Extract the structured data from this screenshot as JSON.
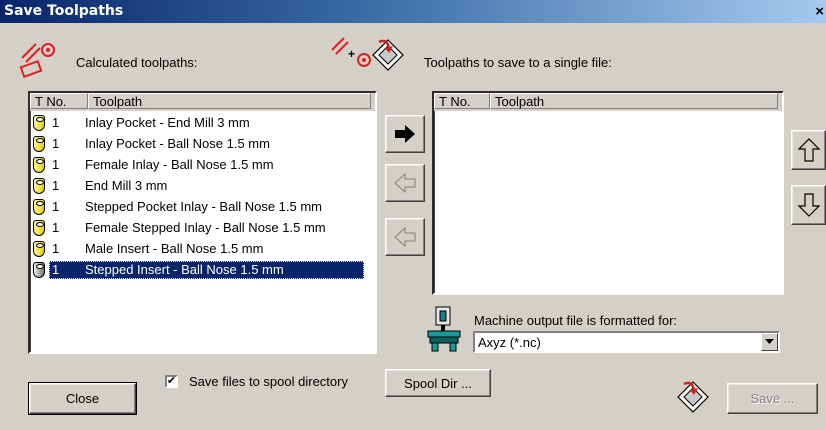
{
  "window": {
    "title": "Save Toolpaths",
    "close_glyph": "×"
  },
  "calculated": {
    "label": "Calculated toolpaths:",
    "columns": [
      "T No.",
      "Toolpath"
    ],
    "rows": [
      {
        "tno": "1",
        "name": "Inlay Pocket - End Mill 3 mm"
      },
      {
        "tno": "1",
        "name": "Inlay Pocket - Ball Nose 1.5 mm"
      },
      {
        "tno": "1",
        "name": "Female Inlay - Ball Nose 1.5 mm"
      },
      {
        "tno": "1",
        "name": "End Mill 3 mm"
      },
      {
        "tno": "1",
        "name": "Stepped Pocket Inlay - Ball Nose 1.5 mm"
      },
      {
        "tno": "1",
        "name": "Female Stepped Inlay - Ball Nose 1.5 mm"
      },
      {
        "tno": "1",
        "name": "Male Insert - Ball Nose 1.5 mm"
      },
      {
        "tno": "1",
        "name": "Stepped Insert - Ball Nose 1.5 mm",
        "selected": true
      }
    ]
  },
  "to_save": {
    "label": "Toolpaths to save to a single file:",
    "columns": [
      "T No.",
      "Toolpath"
    ],
    "rows": []
  },
  "machine": {
    "label": "Machine output file is formatted for:",
    "selected_format": "Axyz (*.nc)"
  },
  "buttons": {
    "close": "Close",
    "spool_dir": "Spool Dir ...",
    "save": "Save ..."
  },
  "spool_checkbox": {
    "label": "Save files to spool directory",
    "checked": true,
    "mark": "✔"
  },
  "colors": {
    "selection": "#0a246a",
    "face": "#d4d0c8",
    "title_start": "#0a246a"
  }
}
